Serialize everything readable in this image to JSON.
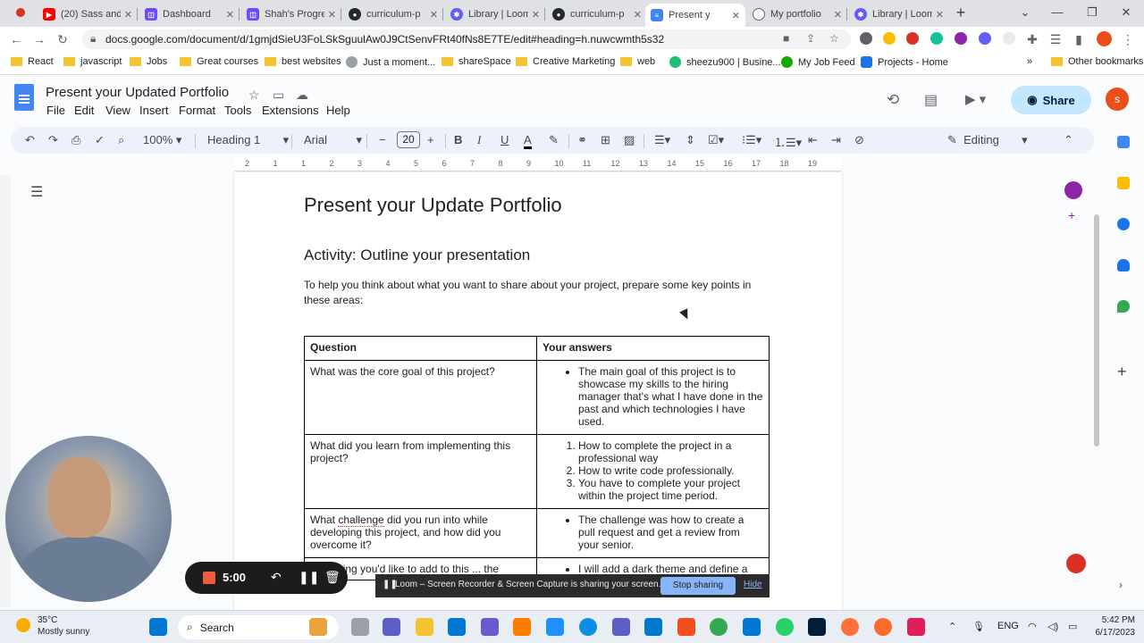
{
  "tabs": [
    {
      "label": "(20) Sass and",
      "color": "#ff0000"
    },
    {
      "label": "Dashboard",
      "color": "#6d4aff"
    },
    {
      "label": "Shah's Progre",
      "color": "#6d4aff"
    },
    {
      "label": "curriculum-p",
      "color": "#24292f"
    },
    {
      "label": "Library | Loom",
      "color": "#625df5"
    },
    {
      "label": "curriculum-p",
      "color": "#24292f"
    },
    {
      "label": "Present y",
      "color": "#4285f4"
    },
    {
      "label": "My portfolio",
      "color": "#5f6368"
    },
    {
      "label": "Library | Loom",
      "color": "#625df5"
    }
  ],
  "address": {
    "url": "docs.google.com/document/d/1gmjdSieU3FoLSkSguulAw0J9CtSenvFRt40fNs8E7TE/edit#heading=h.nuwcwmth5s32"
  },
  "bookmarks": [
    "React",
    "javascript",
    "Jobs",
    "Great courses",
    "best websites",
    "Just a moment...",
    "shareSpace",
    "Creative Marketing",
    "web",
    "sheezu900 | Busine...",
    "My Job Feed",
    "Projects - Home",
    "Other bookmarks"
  ],
  "docs": {
    "title": "Present your Updated Portfolio",
    "menus": [
      "File",
      "Edit",
      "View",
      "Insert",
      "Format",
      "Tools",
      "Extensions",
      "Help"
    ],
    "share_label": "Share",
    "avatar_letter": "s"
  },
  "toolbar": {
    "zoom": "100%",
    "style": "Heading 1",
    "font": "Arial",
    "font_size": "20",
    "mode": "Editing"
  },
  "ruler": [
    "2",
    "1",
    "1",
    "2",
    "3",
    "4",
    "5",
    "6",
    "7",
    "8",
    "9",
    "10",
    "11",
    "12",
    "13",
    "14",
    "15",
    "16",
    "17",
    "18",
    "19"
  ],
  "document": {
    "heading1": "Present your Update Portfolio",
    "heading2": "Activity: Outline your presentation",
    "intro": "To help you think about what you want to share about your project, prepare some key points in these areas:",
    "table": {
      "headers": [
        "Question",
        "Your answers"
      ],
      "rows": [
        {
          "question": "What was the core goal of this project?",
          "answers": [
            "The main goal of this project is to showcase my skills to the hiring manager that's what I have done in the past and which technologies I have used."
          ]
        },
        {
          "question": "What did you learn from implementing this project?",
          "answers": [
            "How to complete the project in a professional way",
            "How to write code professionally.",
            "You have to complete your project within the project time period."
          ]
        },
        {
          "question_pre": "What ",
          "question_word": "challenge",
          "question_post": " did you run into while developing this project, and how did you overcome it?",
          "answers": [
            "The challenge was how to create a pull request and get a review from your senior."
          ]
        },
        {
          "question": "...ne thing you'd like to add to this ... the",
          "answers": [
            "I will add a dark theme and define a"
          ]
        }
      ]
    }
  },
  "loom": {
    "time": "5:00",
    "banner": "Loom – Screen Recorder & Screen Capture is sharing your screen.",
    "stop_label": "Stop sharing",
    "hide_label": "Hide"
  },
  "taskbar": {
    "temp": "35°C",
    "weather": "Mostly sunny",
    "search": "Search",
    "lang": "ENG",
    "time": "5:42 PM",
    "date": "6/17/2023"
  }
}
